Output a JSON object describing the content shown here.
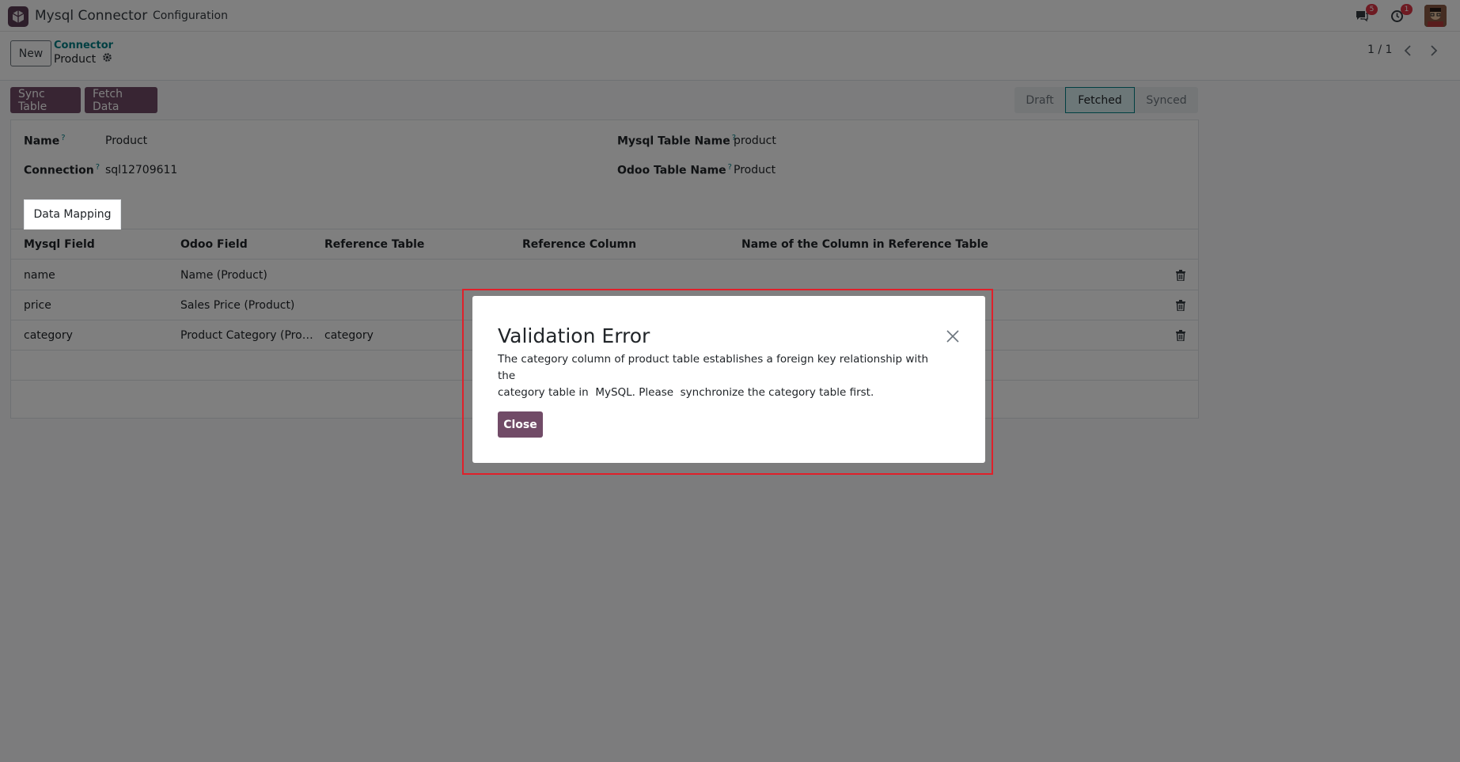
{
  "navbar": {
    "app_name": "Mysql Connector",
    "menu_configuration": "Configuration",
    "messages_badge": "5",
    "activities_badge": "1"
  },
  "control_panel": {
    "new_label": "New",
    "breadcrumb_parent": "Connector",
    "breadcrumb_current": "Product",
    "pager": "1 / 1"
  },
  "form": {
    "buttons": {
      "sync_table": "Sync Table",
      "fetch_data": "Fetch Data"
    },
    "status_steps": [
      "Draft",
      "Fetched",
      "Synced"
    ],
    "active_status": "Fetched",
    "fields": {
      "name_label": "Name",
      "name_value": "Product",
      "connection_label": "Connection",
      "connection_value": "sql12709611",
      "mysql_table_label": "Mysql Table Name",
      "mysql_table_value": "product",
      "odoo_table_label": "Odoo Table Name",
      "odoo_table_value": "Product",
      "help_mark": "?"
    },
    "tab_label": "Data Mapping",
    "table": {
      "headers": [
        "Mysql Field",
        "Odoo Field",
        "Reference Table",
        "Reference Column",
        "Name of the Column in Reference Table"
      ],
      "rows": [
        {
          "mysql_field": "name",
          "odoo_field": "Name (Product)",
          "reference_table": "",
          "reference_column": "",
          "ref_column_name": ""
        },
        {
          "mysql_field": "price",
          "odoo_field": "Sales Price (Product)",
          "reference_table": "",
          "reference_column": "",
          "ref_column_name": ""
        },
        {
          "mysql_field": "category",
          "odoo_field": "Product Category (Produ...",
          "reference_table": "category",
          "reference_column": "",
          "ref_column_name": ""
        }
      ]
    }
  },
  "modal": {
    "title": "Validation Error",
    "body": "The category column of product table establishes a foreign key relationship with the\ncategory table in  MySQL. Please  synchronize the category table first.",
    "close_label": "Close"
  },
  "colors": {
    "brand": "#714b67",
    "link": "#017e84",
    "highlight": "#e0202a"
  }
}
